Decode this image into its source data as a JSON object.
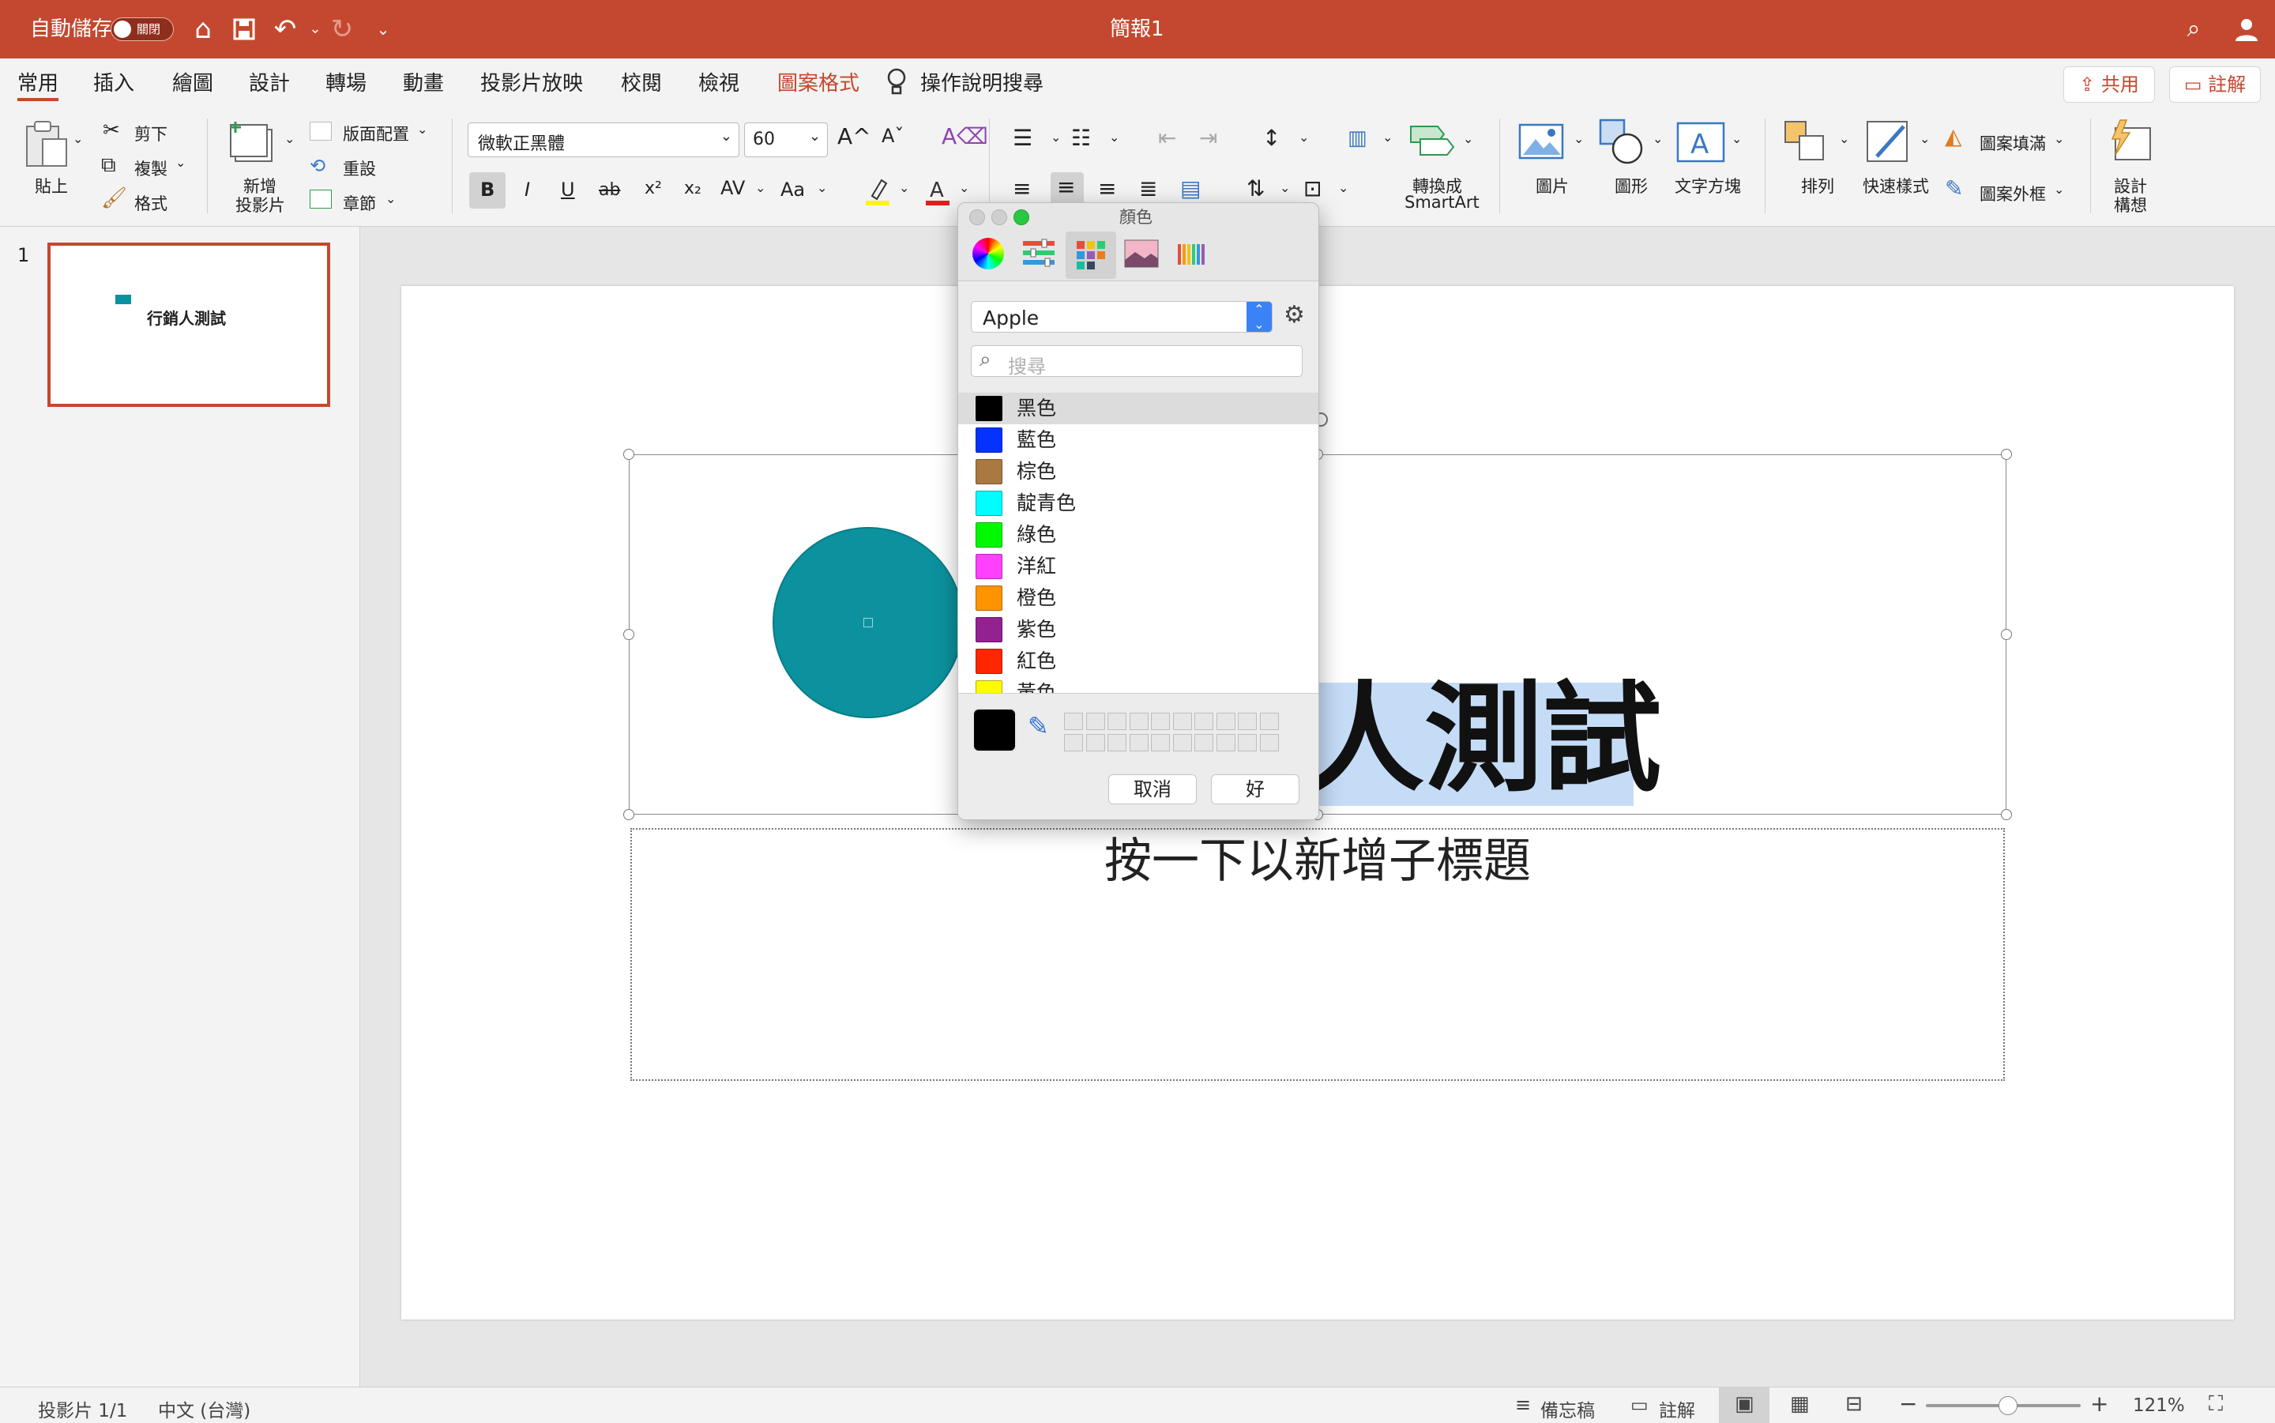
{
  "titlebar": {
    "autosave_label": "自動儲存",
    "autosave_state": "關閉",
    "document_title": "簡報1"
  },
  "tabs": [
    "常用",
    "插入",
    "繪圖",
    "設計",
    "轉場",
    "動畫",
    "投影片放映",
    "校閱",
    "檢視",
    "圖案格式"
  ],
  "tell_me": "操作說明搜尋",
  "share_button": "共用",
  "comments_button": "註解",
  "clipboard": {
    "paste": "貼上",
    "cut": "剪下",
    "copy": "複製",
    "format": "格式"
  },
  "slides_group": {
    "new_slide_line1": "新增",
    "new_slide_line2": "投影片",
    "layout": "版面配置",
    "reset": "重設",
    "section": "章節"
  },
  "font": {
    "name": "微軟正黑體",
    "size": "60",
    "bold": "B",
    "italic": "I",
    "underline": "U",
    "strike": "ab",
    "superscript": "x²",
    "subscript": "x₂",
    "spacing": "AV",
    "case": "Aa",
    "grow": "A^",
    "shrink": "Aˇ"
  },
  "smartart": {
    "line1": "轉換成",
    "line2": "SmartArt"
  },
  "insert_group": {
    "picture": "圖片",
    "shape": "圖形",
    "textbox": "文字方塊"
  },
  "arrange": {
    "arrange": "排列",
    "quick_styles": "快速樣式",
    "shape_fill": "圖案填滿",
    "shape_outline": "圖案外框"
  },
  "designer": {
    "line1": "設計",
    "line2": "構想"
  },
  "thumbnail": {
    "number": "1",
    "title": "行銷人測試"
  },
  "slide": {
    "title_visible": "人測試",
    "subtitle_placeholder": "按一下以新增子標題"
  },
  "color_dialog": {
    "title": "顏色",
    "palette": "Apple",
    "search_placeholder": "搜尋",
    "colors": [
      {
        "name": "黑色",
        "hex": "#000000"
      },
      {
        "name": "藍色",
        "hex": "#0433ff"
      },
      {
        "name": "棕色",
        "hex": "#aa7942"
      },
      {
        "name": "靛青色",
        "hex": "#00fdff"
      },
      {
        "name": "綠色",
        "hex": "#00f900"
      },
      {
        "name": "洋紅",
        "hex": "#ff40ff"
      },
      {
        "name": "橙色",
        "hex": "#ff9300"
      },
      {
        "name": "紫色",
        "hex": "#942192"
      },
      {
        "name": "紅色",
        "hex": "#ff2600"
      },
      {
        "name": "黃色",
        "hex": "#fffb00"
      }
    ],
    "selected_index": 0,
    "current_color": "#000000",
    "cancel": "取消",
    "ok": "好"
  },
  "status": {
    "slide": "投影片 1/1",
    "language": "中文 (台灣)",
    "notes": "備忘稿",
    "comments": "註解",
    "zoom": "121%"
  },
  "colors": {
    "accent": "#c4482f",
    "shape_fill": "#0b929e",
    "selection": "#c5dcf7"
  }
}
